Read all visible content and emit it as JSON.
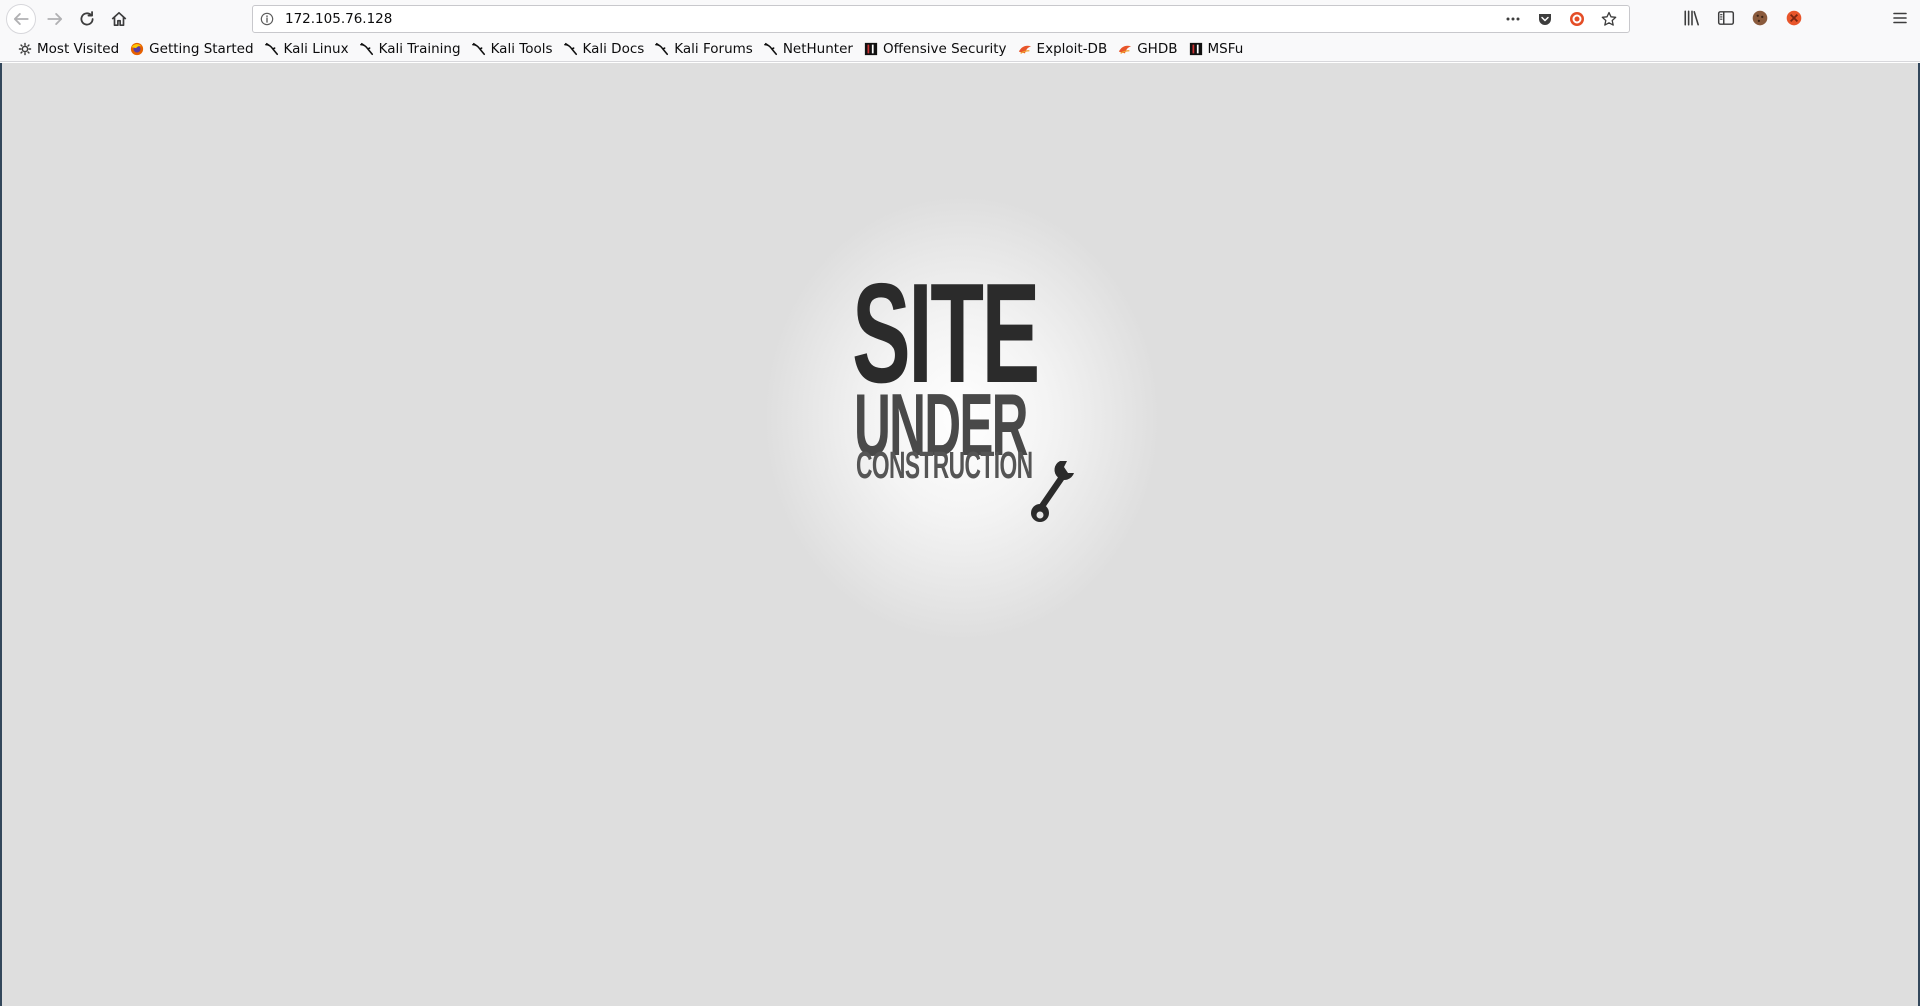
{
  "browser": {
    "url": "172.105.76.128",
    "icons": {
      "back": "back-arrow-icon",
      "forward": "forward-arrow-icon",
      "reload": "reload-icon",
      "home": "home-icon",
      "site_info": "info-icon",
      "page_actions": "more-horizontal-icon",
      "pocket": "pocket-icon",
      "extension": "ublock-icon",
      "bookmark": "star-icon",
      "library": "library-icon",
      "sidebar": "sidebar-icon",
      "cookie": "cookie-icon",
      "addon": "addon-icon",
      "menu": "hamburger-menu-icon"
    }
  },
  "bookmarks": [
    {
      "label": "Most Visited",
      "icon": "gear-icon"
    },
    {
      "label": "Getting Started",
      "icon": "firefox-icon"
    },
    {
      "label": "Kali Linux",
      "icon": "kali-dragon-icon"
    },
    {
      "label": "Kali Training",
      "icon": "kali-dragon-icon"
    },
    {
      "label": "Kali Tools",
      "icon": "kali-dragon-icon"
    },
    {
      "label": "Kali Docs",
      "icon": "kali-dragon-icon"
    },
    {
      "label": "Kali Forums",
      "icon": "kali-dragon-icon"
    },
    {
      "label": "NetHunter",
      "icon": "kali-dragon-icon"
    },
    {
      "label": "Offensive Security",
      "icon": "offsec-icon"
    },
    {
      "label": "Exploit-DB",
      "icon": "exploitdb-icon"
    },
    {
      "label": "GHDB",
      "icon": "exploitdb-icon"
    },
    {
      "label": "MSFu",
      "icon": "offsec-icon"
    }
  ],
  "page": {
    "logo": {
      "line1": "SITE",
      "line2": "UNDER",
      "line3": "CONSTRUCTION",
      "icon": "wrench-icon"
    },
    "colors": {
      "background": "#dedede",
      "logo_dark": "#2b2b2b"
    }
  }
}
